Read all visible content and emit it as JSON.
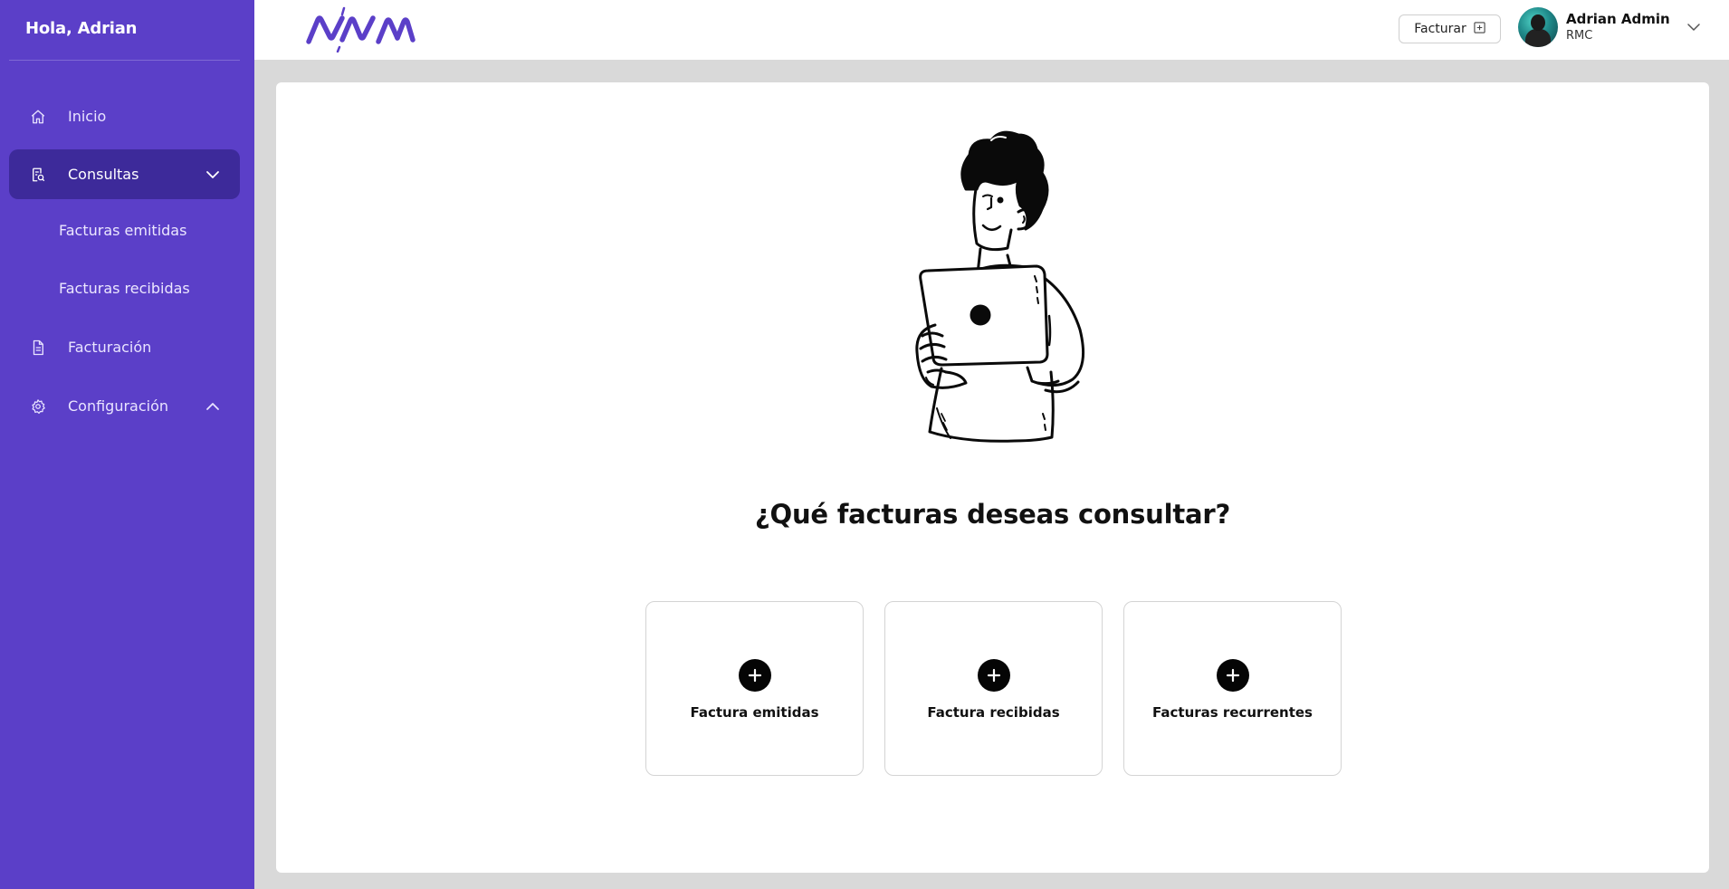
{
  "sidebar": {
    "greeting": "Hola, Adrian",
    "items": [
      {
        "label": "Inicio",
        "icon": "home-icon"
      },
      {
        "label": "Consultas",
        "icon": "document-search-icon"
      },
      {
        "label": "Facturación",
        "icon": "file-icon"
      },
      {
        "label": "Configuración",
        "icon": "gear-icon"
      }
    ],
    "subitems": [
      {
        "label": "Facturas emitidas"
      },
      {
        "label": "Facturas recibidas"
      }
    ]
  },
  "header": {
    "logo": "AVAN",
    "facturar_label": "Facturar",
    "user": {
      "name": "Adrian Admin",
      "org": "RMC"
    }
  },
  "main": {
    "question": "¿Qué facturas deseas consultar?",
    "options": [
      {
        "label": "Factura emitidas"
      },
      {
        "label": "Factura recibidas"
      },
      {
        "label": "Facturas recurrentes"
      }
    ]
  },
  "colors": {
    "sidebar_bg": "#5b3fc8",
    "sidebar_active": "#3d2a9a",
    "brand_logo": "#5b3fc8",
    "page_bg": "#d9d9d9"
  }
}
